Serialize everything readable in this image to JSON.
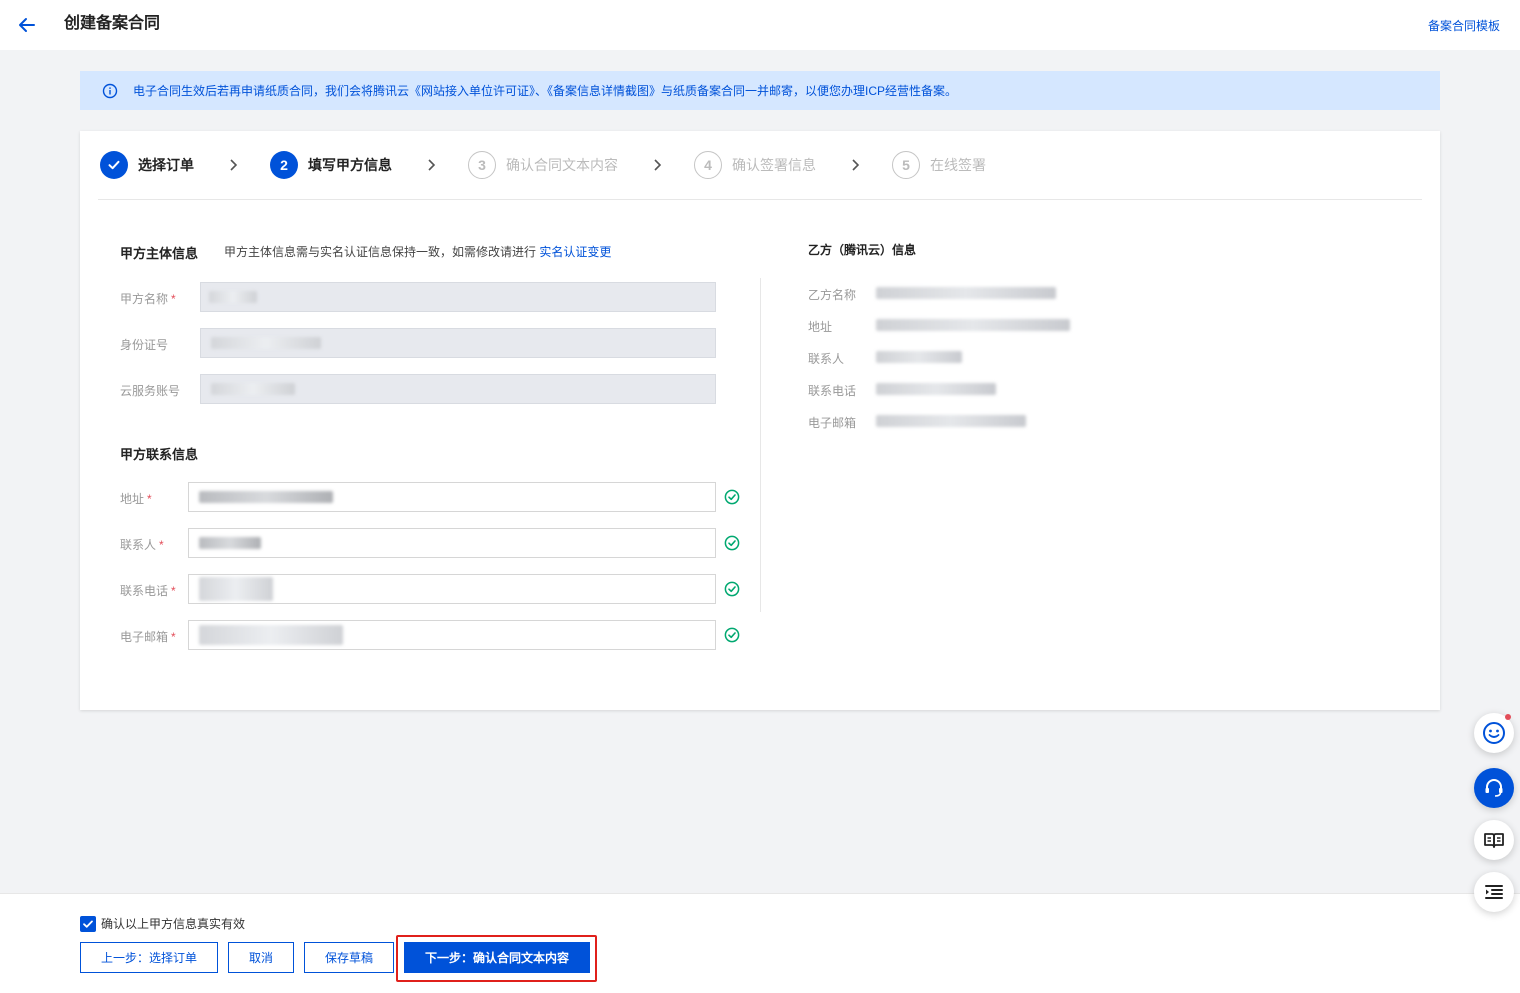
{
  "header": {
    "title": "创建备案合同",
    "template_link": "备案合同模板"
  },
  "notice": {
    "text": "电子合同生效后若再申请纸质合同，我们会将腾讯云《网站接入单位许可证》、《备案信息详情截图》与纸质备案合同一并邮寄，以便您办理ICP经营性备案。"
  },
  "steps": [
    {
      "num": "",
      "label": "选择订单",
      "state": "done"
    },
    {
      "num": "2",
      "label": "填写甲方信息",
      "state": "active"
    },
    {
      "num": "3",
      "label": "确认合同文本内容",
      "state": "pending"
    },
    {
      "num": "4",
      "label": "确认签署信息",
      "state": "pending"
    },
    {
      "num": "5",
      "label": "在线签署",
      "state": "pending"
    }
  ],
  "party_a": {
    "subject_title": "甲方主体信息",
    "subject_hint": "甲方主体信息需与实名认证信息保持一致，如需修改请进行",
    "subject_link": "实名认证变更",
    "fields": {
      "name_label": "甲方名称",
      "id_label": "身份证号",
      "account_label": "云服务账号"
    },
    "contact_title": "甲方联系信息",
    "contact_fields": {
      "address_label": "地址",
      "contact_label": "联系人",
      "phone_label": "联系电话",
      "email_label": "电子邮箱"
    },
    "required_mark": "*"
  },
  "party_b": {
    "title": "乙方（腾讯云）信息",
    "labels": {
      "name": "乙方名称",
      "address": "地址",
      "contact": "联系人",
      "phone": "联系电话",
      "email": "电子邮箱"
    }
  },
  "footer": {
    "confirm_text": "确认以上甲方信息真实有效",
    "confirm_checked": true,
    "prev_button": "上一步：选择订单",
    "cancel_button": "取消",
    "save_button": "保存草稿",
    "next_button": "下一步：确认合同文本内容"
  },
  "colors": {
    "primary": "#0052d9",
    "success": "#00a870",
    "required": "#e34d59",
    "highlight": "#e0201b"
  }
}
